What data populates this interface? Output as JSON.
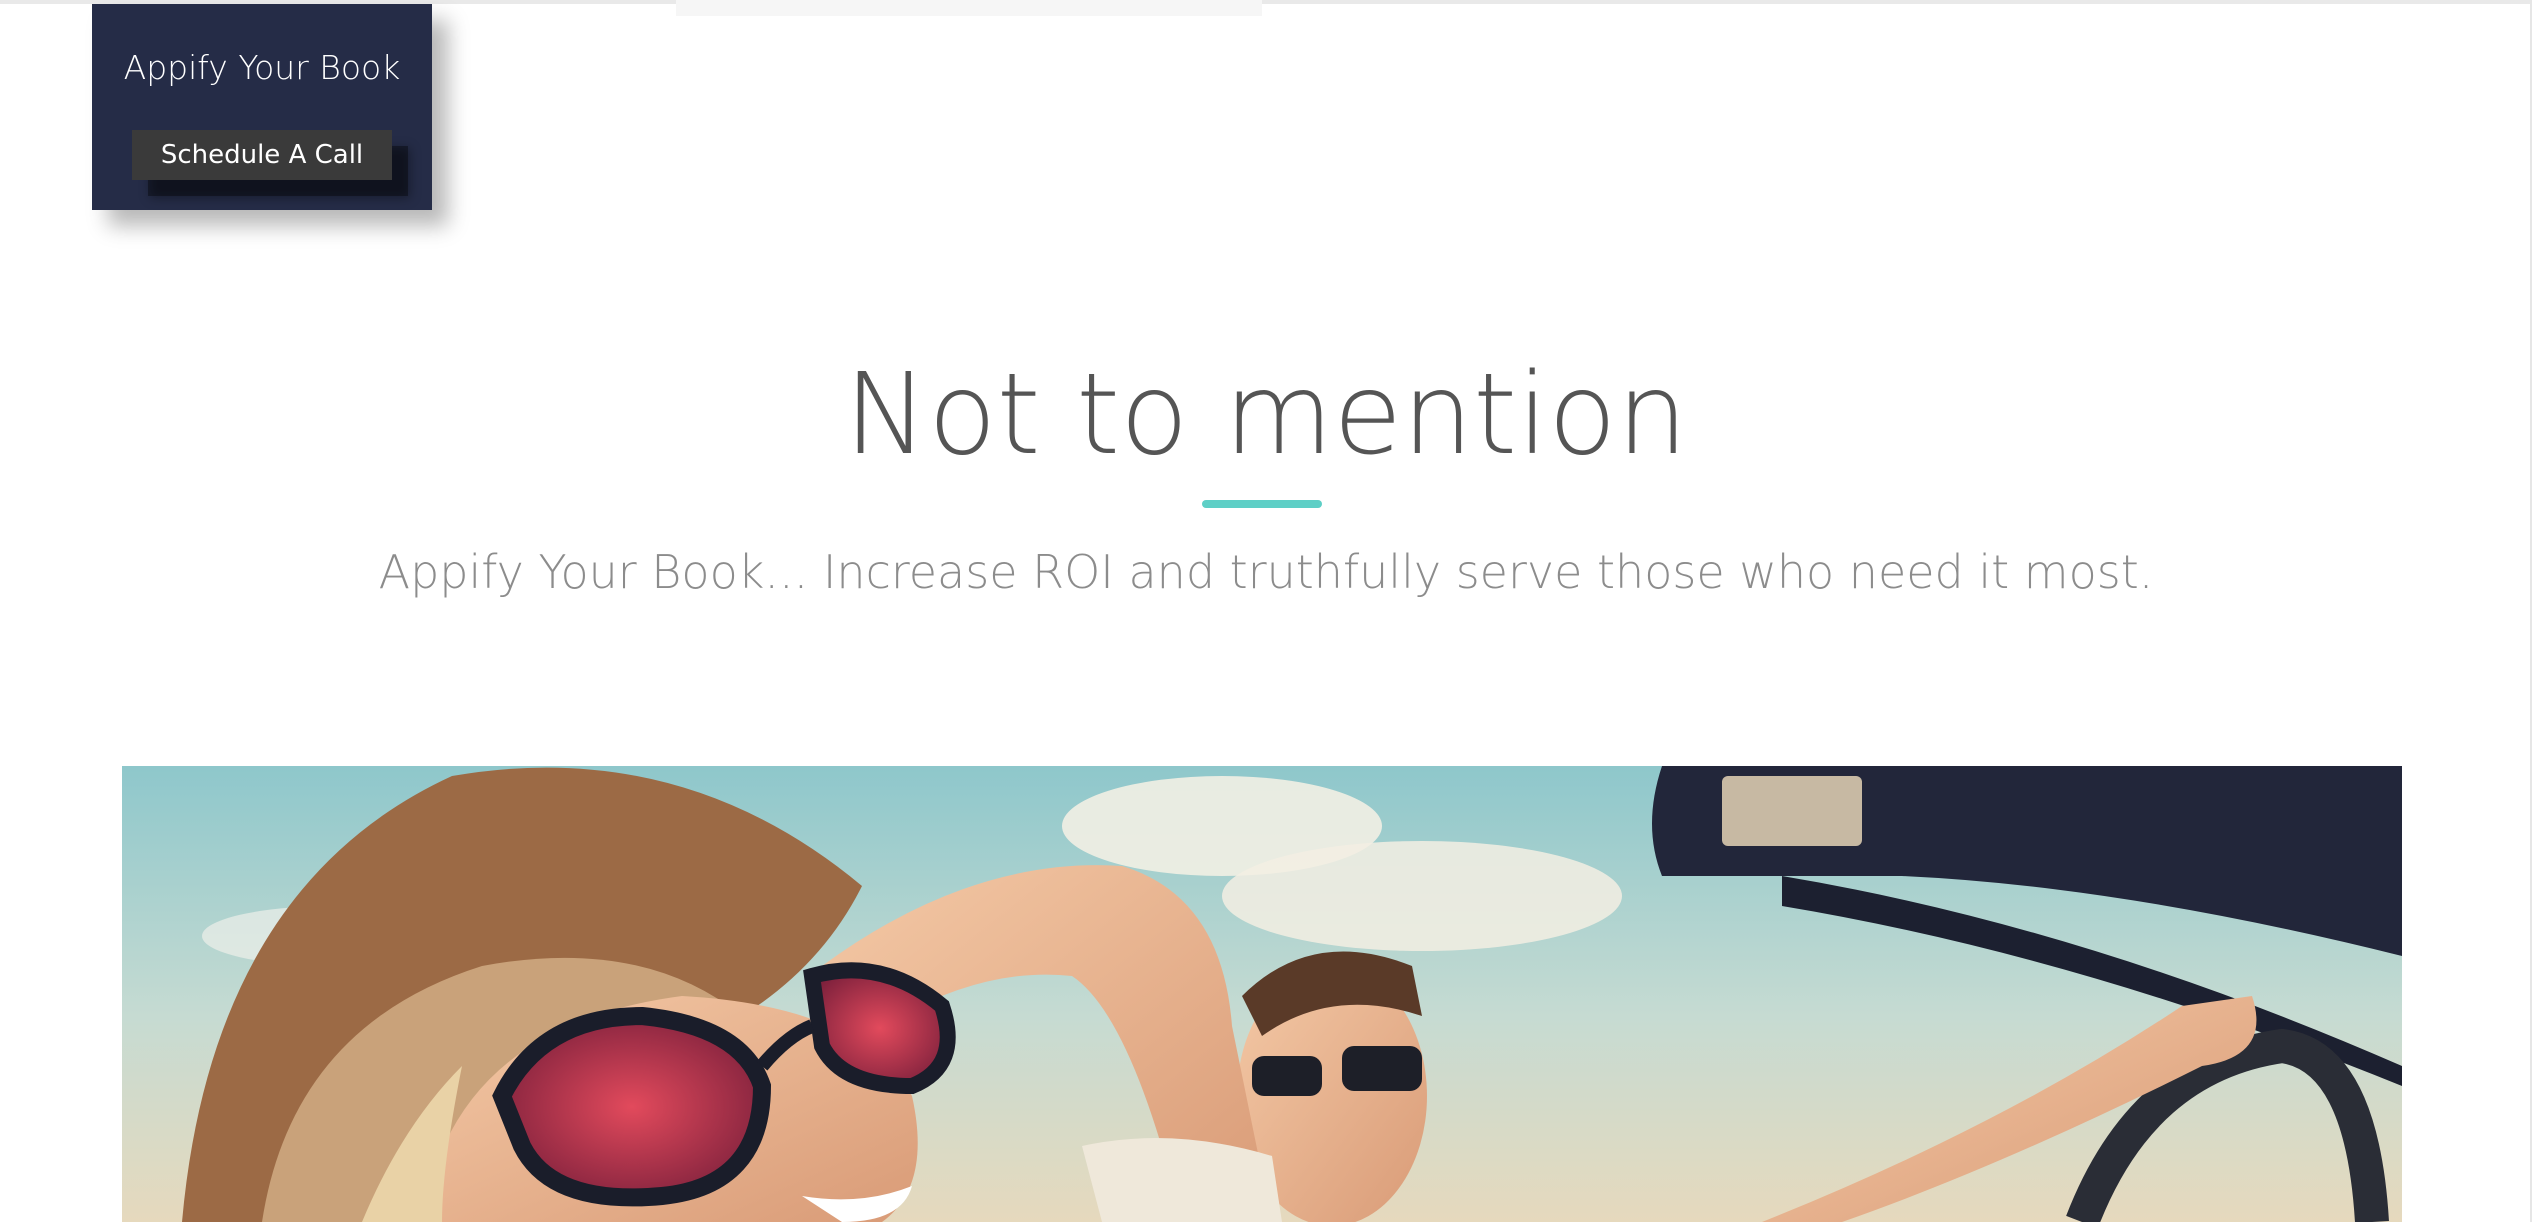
{
  "promo": {
    "title": "Appify Your Book",
    "cta_label": "Schedule A Call"
  },
  "section": {
    "heading": "Not to mention",
    "subtitle": "Appify Your Book... Increase ROI and truthfully serve those who need it most."
  },
  "hero": {
    "image_subject": "two people in convertible wearing sunglasses"
  },
  "colors": {
    "promo_bg": "#252c47",
    "cta_bg": "#3a3a3a",
    "accent": "#5ecfc6",
    "heading_text": "#555555",
    "subtitle_text": "#8c8c8c"
  }
}
